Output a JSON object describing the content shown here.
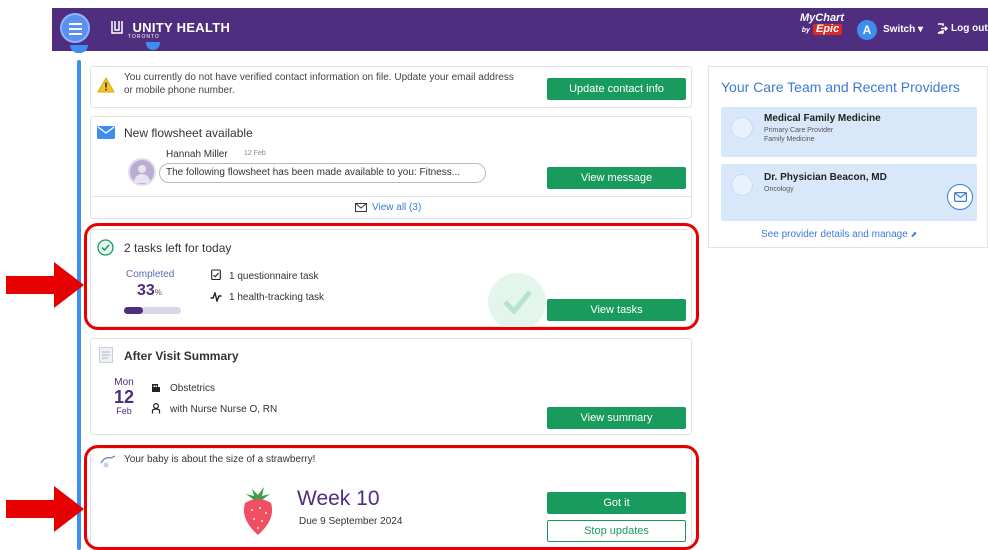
{
  "header": {
    "logo_main": "UNITY HEALTH",
    "logo_sub": "TORONTO",
    "mychart_label": "MyChart",
    "mychart_by": "by",
    "epic_label": "Epic",
    "avatar_letter": "A",
    "switch_label": "Switch",
    "logout_label": "Log out",
    "bar_color": "#4f2d7f"
  },
  "contact_card": {
    "message": "You currently do not have verified contact information on file. Update your email address or mobile phone number.",
    "button": "Update contact info"
  },
  "flowsheet_card": {
    "title": "New flowsheet available",
    "sender": "Hannah Miller",
    "date": "12 Feb",
    "preview": "The following flowsheet has been made available to you: Fitness...",
    "button": "View message",
    "view_all": "View all (3)"
  },
  "tasks_card": {
    "title": "2 tasks left for today",
    "completed_label": "Completed",
    "percent_value": "33",
    "percent_sign": "%",
    "progress_fraction": 0.33,
    "task1": "1 questionnaire task",
    "task2": "1 health-tracking task",
    "button": "View tasks"
  },
  "summary_card": {
    "title": "After Visit Summary",
    "day": "Mon",
    "date_num": "12",
    "month": "Feb",
    "department": "Obstetrics",
    "provider": "with Nurse Nurse O, RN",
    "button": "View summary"
  },
  "baby_card": {
    "message": "Your baby is about the size of a strawberry!",
    "week": "Week 10",
    "due": "Due 9 September 2024",
    "got_it": "Got it",
    "stop": "Stop updates"
  },
  "care_team": {
    "title": "Your Care Team and Recent Providers",
    "providers": [
      {
        "name": "Medical Family Medicine",
        "role": "Primary Care Provider",
        "specialty": "Family Medicine"
      },
      {
        "name": "Dr. Physician Beacon, MD",
        "specialty": "Oncology"
      }
    ],
    "link": "See provider details and manage"
  },
  "colors": {
    "accent_green": "#1a9b5e",
    "link_blue": "#3a7bd5",
    "highlight_red": "#e60000"
  }
}
